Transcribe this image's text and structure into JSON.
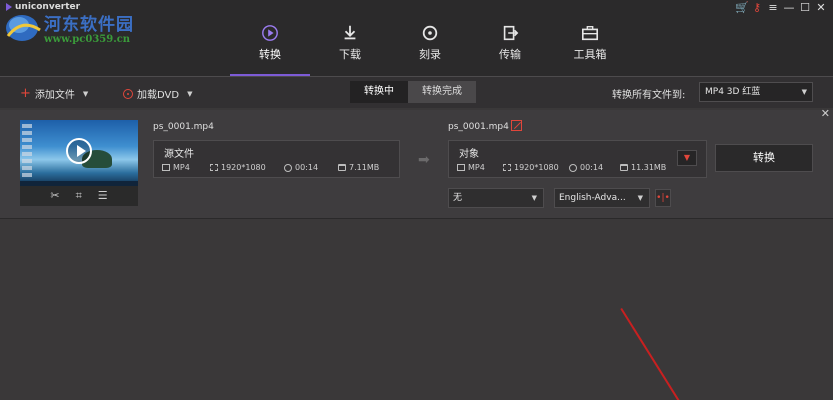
{
  "window": {
    "app_name": "uniconverter"
  },
  "watermark": {
    "title": "河东软件园",
    "url": "www.pc0359.cn"
  },
  "win_controls": [
    {
      "name": "cart-icon",
      "glyph": "🛒"
    },
    {
      "name": "key-icon",
      "glyph": "⚷"
    },
    {
      "name": "menu-icon",
      "glyph": "≡"
    },
    {
      "name": "minimize-icon",
      "glyph": "—"
    },
    {
      "name": "maximize-icon",
      "glyph": "☐"
    },
    {
      "name": "close-icon",
      "glyph": "✕"
    }
  ],
  "nav": [
    {
      "label": "转换",
      "icon": "convert-icon",
      "active": true
    },
    {
      "label": "下载",
      "icon": "download-icon",
      "active": false
    },
    {
      "label": "刻录",
      "icon": "burn-icon",
      "active": false
    },
    {
      "label": "传输",
      "icon": "transfer-icon",
      "active": false
    },
    {
      "label": "工具箱",
      "icon": "toolbox-icon",
      "active": false
    }
  ],
  "toolbar": {
    "add_files": "添加文件",
    "load_dvd": "加载DVD",
    "tab_converting": "转换中",
    "tab_done": "转换完成",
    "convert_all_label": "转换所有文件到:",
    "convert_all_value": "MP4 3D 红蓝"
  },
  "file": {
    "source_name": "ps_0001.mp4",
    "target_name": "ps_0001.mp4",
    "source": {
      "title": "源文件",
      "format": "MP4",
      "resolution": "1920*1080",
      "duration": "00:14",
      "size": "7.11MB"
    },
    "target": {
      "title": "对象",
      "format": "MP4",
      "resolution": "1920*1080",
      "duration": "00:14",
      "size": "11.31MB"
    },
    "convert_button": "转换",
    "subtitle_value": "无",
    "audio_value": "English-Adva..."
  },
  "colors": {
    "accent": "#7d5bd6",
    "red": "#e1463b"
  }
}
